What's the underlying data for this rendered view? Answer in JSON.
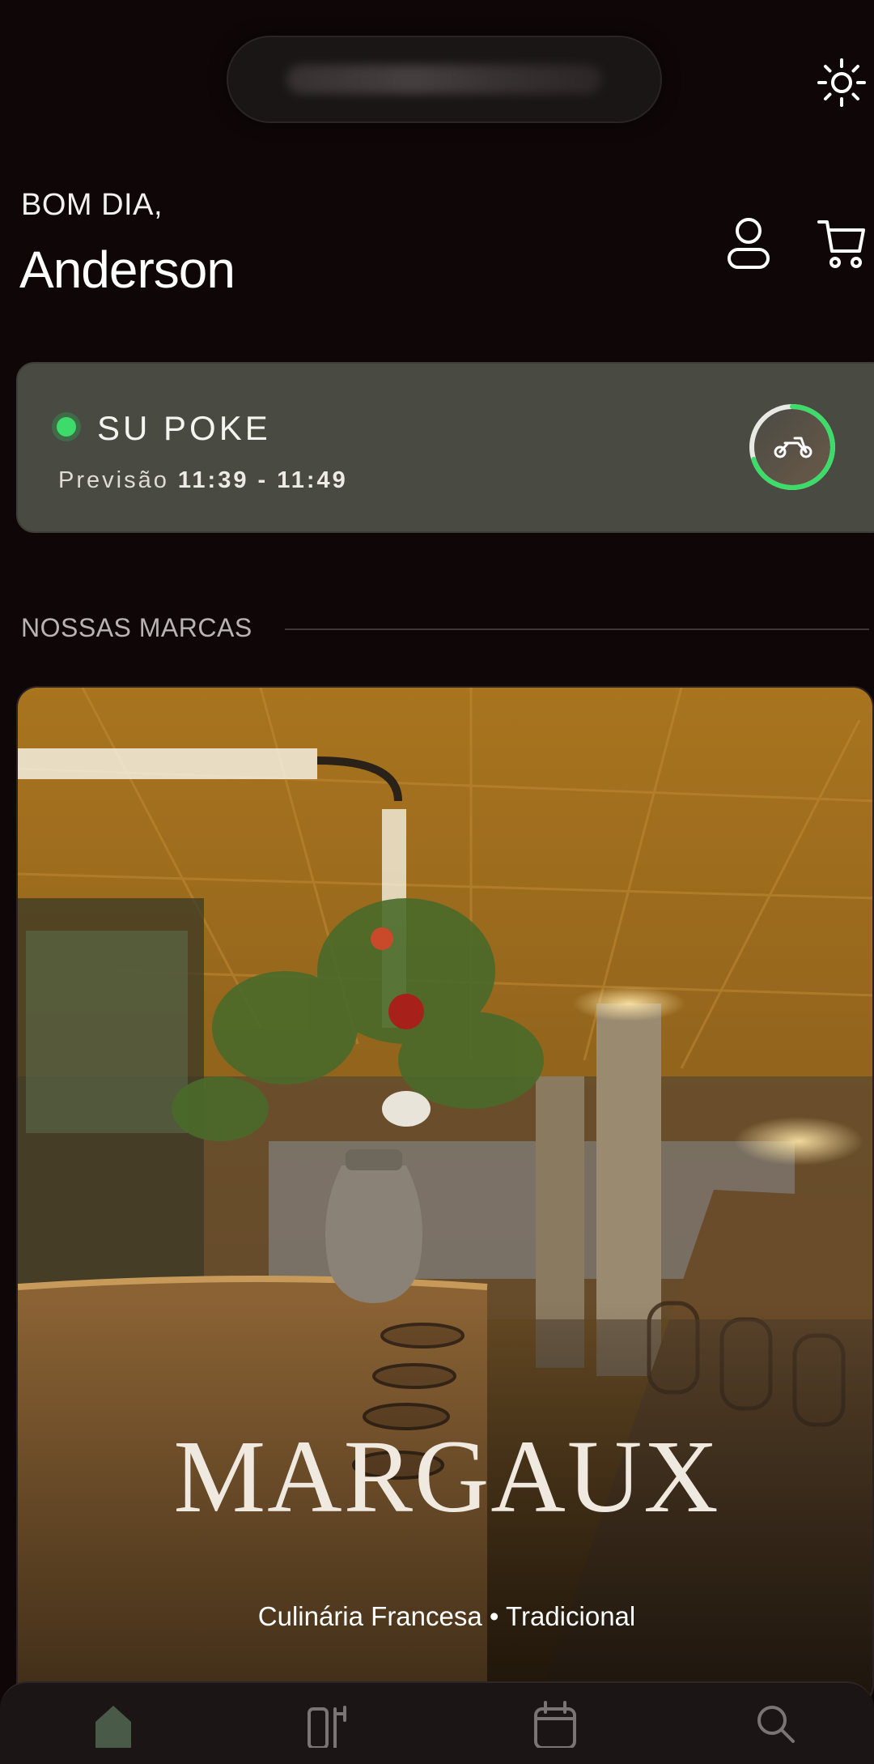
{
  "status_pill": {
    "text": ""
  },
  "header": {
    "greeting": "BOM DIA,",
    "user_name": "Anderson",
    "icons": [
      "sun-icon",
      "user-icon",
      "cart-icon"
    ]
  },
  "order": {
    "store_name": "SU POKE",
    "eta_prefix": "Previsão",
    "eta_range": "11:39 - 11:49",
    "status_color": "#3ddc6a",
    "progress": 0.7
  },
  "brands_section": {
    "label": "NOSSAS MARCAS",
    "brands": [
      {
        "name": "MARGAUX",
        "cuisine": "Culinária Francesa",
        "style": "Tradicional",
        "separator": "•"
      }
    ]
  },
  "bottom_nav": {
    "items": [
      {
        "name": "home",
        "icon": "home-icon",
        "active": true
      },
      {
        "name": "menu",
        "icon": "menu-icon",
        "active": false
      },
      {
        "name": "reservations",
        "icon": "calendar-icon",
        "active": false
      },
      {
        "name": "search",
        "icon": "search-icon",
        "active": false
      }
    ]
  },
  "colors": {
    "background": "#0f0707",
    "card": "#494a42",
    "accent": "#3ddc6a"
  }
}
